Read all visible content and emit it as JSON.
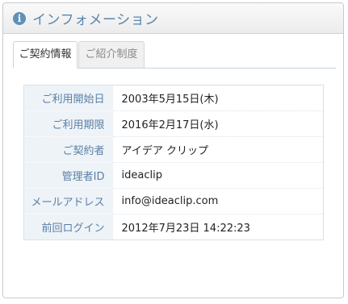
{
  "panel": {
    "title": "インフォメーション",
    "icon": "info-icon"
  },
  "tabs": [
    {
      "label": "ご契約情報",
      "active": true
    },
    {
      "label": "ご紹介制度",
      "active": false
    }
  ],
  "rows": [
    {
      "label": "ご利用開始日",
      "value": "2003年5月15日(木)"
    },
    {
      "label": "ご利用期限",
      "value": "2016年2月17日(水)"
    },
    {
      "label": "ご契約者",
      "value": "アイデア クリップ"
    },
    {
      "label": "管理者ID",
      "value": "ideaclip"
    },
    {
      "label": "メールアドレス",
      "value": "info@ideaclip.com"
    },
    {
      "label": "前回ログイン",
      "value": "2012年7月23日 14:22:23"
    }
  ],
  "colors": {
    "accent": "#5a86b0",
    "label_bg": "#eef3f8",
    "label_text": "#5a7fa5"
  }
}
